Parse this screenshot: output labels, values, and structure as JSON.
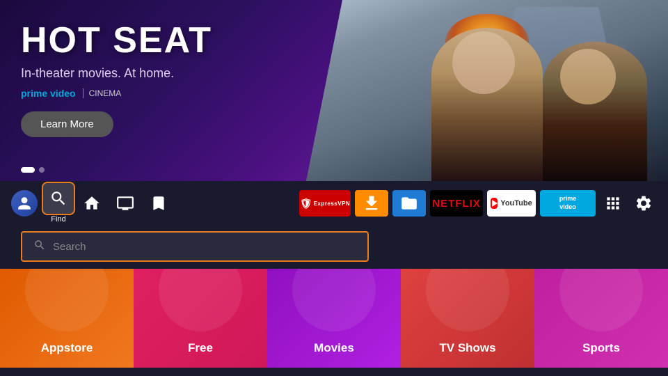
{
  "hero": {
    "title": "HOT SEAT",
    "subtitle": "In-theater movies. At home.",
    "brand": "prime video",
    "cinema": "CINEMA",
    "learn_more": "Learn More",
    "dots": [
      true,
      false
    ]
  },
  "navbar": {
    "find_label": "Find",
    "icons": [
      "user",
      "search",
      "home",
      "tv",
      "bookmark"
    ],
    "apps": [
      {
        "name": "ExpressVPN",
        "id": "expressvpn"
      },
      {
        "name": "Downloader",
        "id": "downloader"
      },
      {
        "name": "File Manager",
        "id": "file-manager"
      },
      {
        "name": "Netflix",
        "id": "netflix"
      },
      {
        "name": "YouTube",
        "id": "youtube"
      },
      {
        "name": "Prime Video",
        "id": "prime-video"
      }
    ]
  },
  "search": {
    "placeholder": "Search"
  },
  "categories": [
    {
      "label": "Appstore",
      "color": "#e05a00"
    },
    {
      "label": "Free",
      "color": "#e02060"
    },
    {
      "label": "Movies",
      "color": "#9010c0"
    },
    {
      "label": "TV Shows",
      "color": "#e04040"
    },
    {
      "label": "Sports",
      "color": "#c020a0"
    }
  ]
}
